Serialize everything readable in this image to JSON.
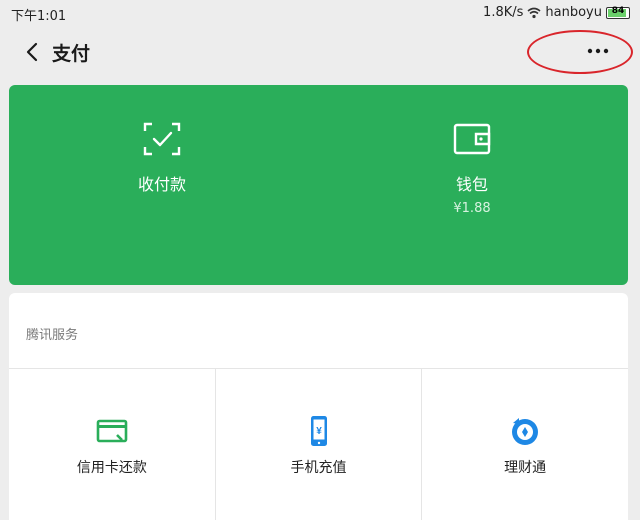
{
  "status_bar": {
    "time": "下午1:01",
    "speed": "1.8K/s",
    "network": "hanboyu",
    "battery": "84"
  },
  "nav": {
    "title": "支付"
  },
  "wallet_card": {
    "background_color": "#2aae5a",
    "actions": [
      {
        "label": "收付款",
        "icon": "scan-pay-icon"
      },
      {
        "label": "钱包",
        "sub": "¥1.88",
        "icon": "wallet-icon"
      }
    ]
  },
  "services": {
    "title": "腾讯服务",
    "items": [
      {
        "label": "信用卡还款",
        "icon": "credit-card-icon"
      },
      {
        "label": "手机充值",
        "icon": "phone-recharge-icon"
      },
      {
        "label": "理财通",
        "icon": "wealth-icon"
      }
    ]
  },
  "annotation_color": "#d9252b"
}
